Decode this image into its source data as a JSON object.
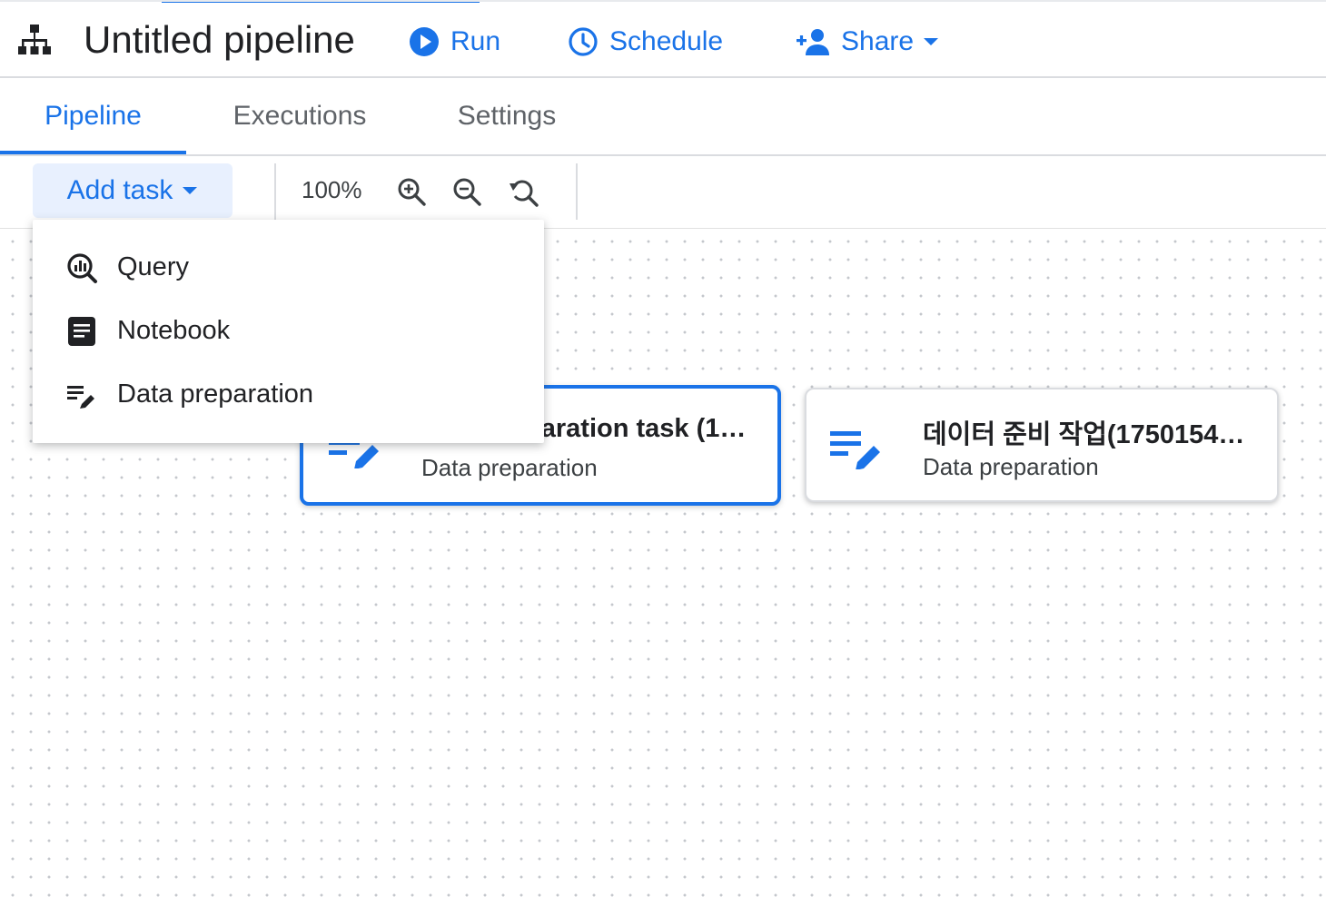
{
  "header": {
    "title": "Untitled pipeline",
    "run_label": "Run",
    "schedule_label": "Schedule",
    "share_label": "Share",
    "accent_color": "#1a73e8"
  },
  "tabs": [
    {
      "label": "Pipeline",
      "active": true
    },
    {
      "label": "Executions",
      "active": false
    },
    {
      "label": "Settings",
      "active": false
    }
  ],
  "toolbar": {
    "add_task_label": "Add task",
    "zoom_level": "100%"
  },
  "add_task_menu": {
    "items": [
      {
        "label": "Query",
        "icon": "query-icon"
      },
      {
        "label": "Notebook",
        "icon": "notebook-icon"
      },
      {
        "label": "Data preparation",
        "icon": "data-preparation-icon"
      }
    ]
  },
  "canvas": {
    "nodes": [
      {
        "title": "Data preparation task (1…",
        "subtitle": "Data preparation",
        "selected": true,
        "icon": "data-preparation-icon"
      },
      {
        "title": "데이터 준비 작업(1750154…",
        "subtitle": "Data preparation",
        "selected": false,
        "icon": "data-preparation-icon"
      }
    ]
  }
}
